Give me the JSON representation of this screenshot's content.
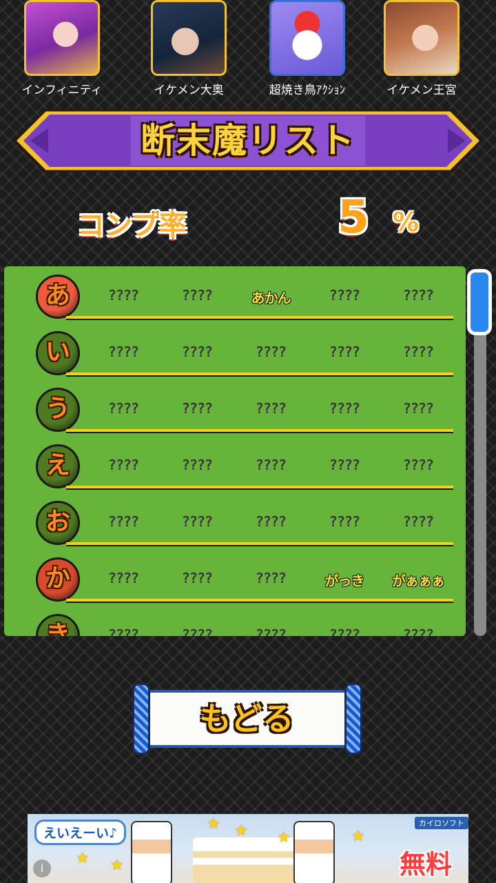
{
  "apps": [
    {
      "name": "インフィニティ"
    },
    {
      "name": "イケメン大奥"
    },
    {
      "name": "超焼き鳥ｱｸｼｮﾝ"
    },
    {
      "name": "イケメン王宮"
    }
  ],
  "title": "断末魔リスト",
  "completion": {
    "label": "コンプ率",
    "value": "5",
    "unit": "%"
  },
  "list": {
    "rows": [
      {
        "kana": "あ",
        "color": "#f05a3a",
        "entries": [
          "????",
          "????",
          "あかん",
          "????",
          "????"
        ]
      },
      {
        "kana": "い",
        "color": "#4f7a20",
        "entries": [
          "????",
          "????",
          "????",
          "????",
          "????"
        ]
      },
      {
        "kana": "う",
        "color": "#4f7a20",
        "entries": [
          "????",
          "????",
          "????",
          "????",
          "????"
        ]
      },
      {
        "kana": "え",
        "color": "#4f7a20",
        "entries": [
          "????",
          "????",
          "????",
          "????",
          "????"
        ]
      },
      {
        "kana": "お",
        "color": "#4f7a20",
        "entries": [
          "????",
          "????",
          "????",
          "????",
          "????"
        ]
      },
      {
        "kana": "か",
        "color": "#d84a2a",
        "entries": [
          "????",
          "????",
          "????",
          "がっき",
          "がぁぁぁ"
        ]
      },
      {
        "kana": "き",
        "color": "#4f7a20",
        "entries": [
          "????",
          "????",
          "????",
          "????",
          "????"
        ]
      }
    ],
    "known_color": "#f6e232",
    "unknown_color": "#3a3a3a"
  },
  "back_button": {
    "label": "もどる"
  },
  "ad": {
    "bubble": "えいえーい♪",
    "brand": "カイロソフト",
    "badge": "無料",
    "info": "i"
  }
}
